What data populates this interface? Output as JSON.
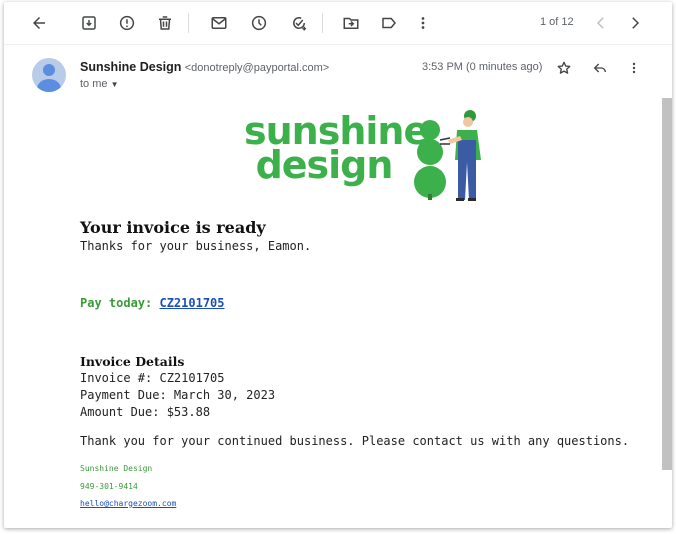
{
  "toolbar": {
    "icons": [
      "back-arrow-icon",
      "archive-icon",
      "report-spam-icon",
      "delete-icon",
      "mark-unread-icon",
      "snooze-icon",
      "add-task-icon",
      "move-to-icon",
      "label-icon",
      "more-vert-icon"
    ],
    "pager": "1 of 12"
  },
  "header": {
    "sender_name": "Sunshine Design",
    "sender_email": "<donotreply@payportal.com>",
    "recipient": "to me",
    "time": "3:53 PM (0 minutes ago)"
  },
  "logo": {
    "line1": "sunshine",
    "line2": "design",
    "color": "#3cb04a"
  },
  "body": {
    "title": "Your invoice is ready",
    "thanks": "Thanks for your business, Eamon.",
    "pay_label": "Pay today:",
    "pay_link": "CZ2101705",
    "details_title": "Invoice Details",
    "invoice_number": "Invoice #: CZ2101705",
    "payment_due": "Payment Due: March 30, 2023",
    "amount_due": "Amount Due: $53.88",
    "closing": "Thank you for your continued business. Please contact us with any questions."
  },
  "signature": {
    "company": "Sunshine Design",
    "phone": "949-301-9414",
    "email": "hello@chargezoom.com"
  }
}
